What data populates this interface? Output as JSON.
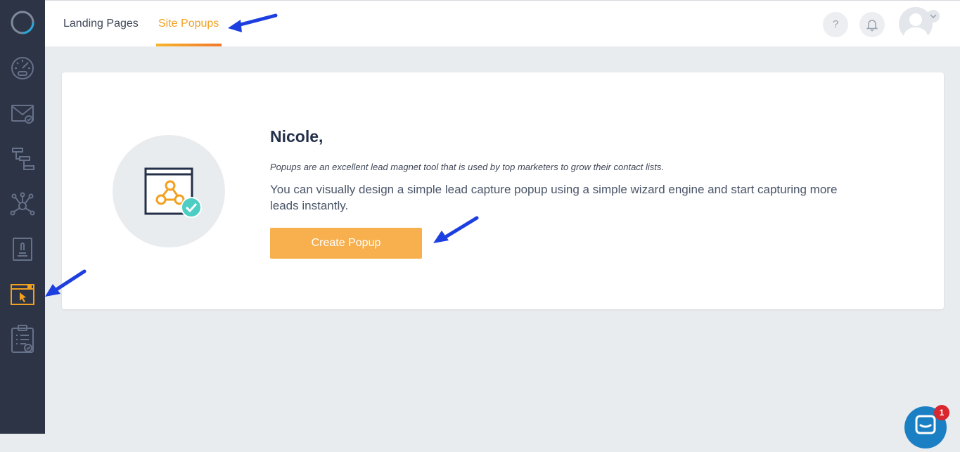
{
  "colors": {
    "sidebar_bg": "#2c3445",
    "accent": "#f2a020",
    "button_bg": "#f7b04d",
    "annotation_arrow": "#1d3fe0",
    "chat_bubble": "#1b7fc4",
    "chat_badge": "#d9262f"
  },
  "sidebar": {
    "items": [
      {
        "icon": "loading-logo-icon"
      },
      {
        "icon": "dashboard-gauge-icon"
      },
      {
        "icon": "email-campaign-icon"
      },
      {
        "icon": "workflow-tree-icon"
      },
      {
        "icon": "network-hub-icon"
      },
      {
        "icon": "form-document-icon"
      },
      {
        "icon": "site-popup-icon",
        "active": true
      },
      {
        "icon": "checklist-clipboard-icon"
      }
    ]
  },
  "header": {
    "tabs": [
      {
        "label": "Landing Pages",
        "active": false
      },
      {
        "label": "Site Popups",
        "active": true
      }
    ],
    "help_label": "?",
    "icons": [
      "help-icon",
      "bell-icon",
      "avatar-icon",
      "chevron-down-icon"
    ]
  },
  "main": {
    "greeting": "Nicole,",
    "intro": "Popups are an excellent lead magnet tool that is used by top marketers to grow their contact lists.",
    "description": "You can visually design a simple lead capture popup using a simple wizard engine and start capturing more leads instantly.",
    "button_label": "Create Popup",
    "illustration_icon": "popup-webhook-check-icon"
  },
  "chat": {
    "badge_count": "1",
    "icon": "chat-icon"
  }
}
